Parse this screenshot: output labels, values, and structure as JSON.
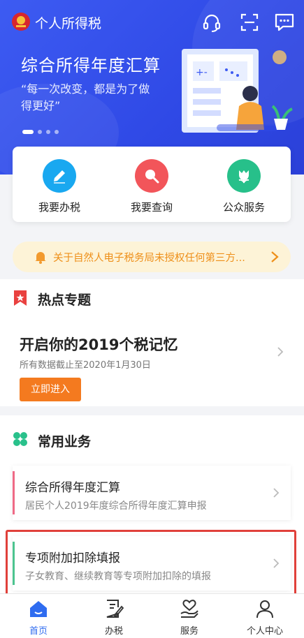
{
  "header": {
    "app_title": "个人所得税",
    "icons": [
      "logo-emblem-icon",
      "headset-icon",
      "scan-icon",
      "message-icon"
    ]
  },
  "banner": {
    "title": "综合所得年度汇算",
    "subtitle": "“每一次改变，都是为了做得更好”",
    "slide_count": 4,
    "active_slide": 1
  },
  "quick_actions": [
    {
      "label": "我要办税",
      "icon": "edit-icon",
      "color": "#19a8f0"
    },
    {
      "label": "我要查询",
      "icon": "search-icon",
      "color": "#f2555a"
    },
    {
      "label": "公众服务",
      "icon": "tulip-icon",
      "color": "#27c08a"
    }
  ],
  "notice": {
    "text": "关于自然人电子税务局未授权任何第三方...",
    "color": "#ee8f19"
  },
  "hot_topics": {
    "heading": "热点专题",
    "promo_title": "开启你的2019个税记忆",
    "promo_sub": "所有数据截止至2020年1月30日",
    "button_label": "立即进入",
    "button_color": "#f47a1f"
  },
  "common_business": {
    "heading": "常用业务",
    "items": [
      {
        "title": "综合所得年度汇算",
        "desc": "居民个人2019年度综合所得年度汇算申报",
        "accent": "#ef6a86"
      },
      {
        "title": "专项附加扣除填报",
        "desc": "子女教育、继续教育等专项附加扣除的填报",
        "accent": "#4cc48f"
      }
    ]
  },
  "tabbar": {
    "tabs": [
      {
        "label": "首页",
        "icon": "home-icon",
        "active": true
      },
      {
        "label": "办税",
        "icon": "document-edit-icon",
        "active": false
      },
      {
        "label": "服务",
        "icon": "heart-hand-icon",
        "active": false
      },
      {
        "label": "个人中心",
        "icon": "person-icon",
        "active": false
      }
    ],
    "active_color": "#2f6cf0"
  }
}
